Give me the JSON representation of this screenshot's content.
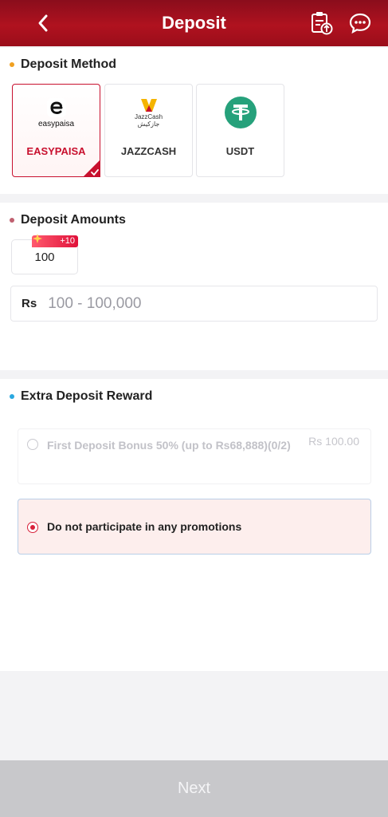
{
  "header": {
    "title": "Deposit",
    "back_icon": "chevron-left-icon",
    "records_icon": "clipboard-upload-icon",
    "support_icon": "chat-support-icon"
  },
  "deposit_method": {
    "title": "Deposit Method",
    "dot_color": "#f0a020",
    "methods": [
      {
        "label": "EASYPAISA",
        "logo_text": "easypaisa",
        "selected": true
      },
      {
        "label": "JAZZCASH",
        "logo_text": "JazzCash",
        "logo_subtext": "جازکیش",
        "selected": false
      },
      {
        "label": "USDT",
        "logo_text": "T",
        "selected": false
      }
    ]
  },
  "deposit_amounts": {
    "title": "Deposit Amounts",
    "dot_color": "#c06070",
    "chips": [
      {
        "value": "100",
        "bonus": "+10"
      }
    ],
    "currency": "Rs",
    "placeholder": "100 - 100,000"
  },
  "extra_reward": {
    "title": "Extra Deposit Reward",
    "dot_color": "#2aa8e0",
    "options": [
      {
        "text": "First Deposit Bonus 50% (up to Rs68,888)(0/2)",
        "amount": "Rs 100.00",
        "disabled": true
      },
      {
        "text": "Do not participate in any promotions",
        "selected": true
      }
    ]
  },
  "footer": {
    "next_label": "Next"
  },
  "colors": {
    "brand": "#b0121f",
    "accent": "#c8102e"
  }
}
